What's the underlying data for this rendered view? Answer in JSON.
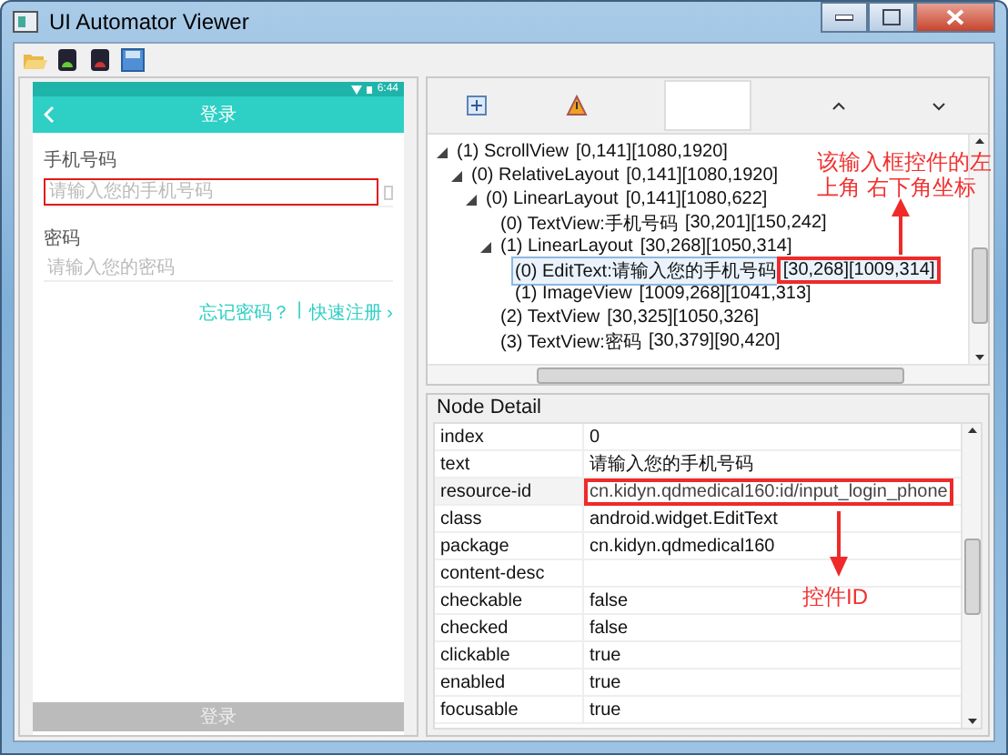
{
  "window": {
    "title": "UI Automator Viewer"
  },
  "device": {
    "status_time": "6:44",
    "header_title": "登录",
    "fields": [
      {
        "label": "手机号码",
        "placeholder": "请输入您的手机号码"
      },
      {
        "label": "密码",
        "placeholder": "请输入您的密码"
      }
    ],
    "links": [
      "忘记密码？",
      "|",
      "快速注册 ›"
    ],
    "submit": "登录"
  },
  "tree": {
    "nodes": [
      {
        "label": "(1) ScrollView",
        "bounds": "[0,141][1080,1920]",
        "expanded": true,
        "selected": false,
        "children": [
          {
            "label": "(0) RelativeLayout",
            "bounds": "[0,141][1080,1920]",
            "expanded": true,
            "selected": false,
            "children": [
              {
                "label": "(0) LinearLayout",
                "bounds": "[0,141][1080,622]",
                "expanded": true,
                "selected": false,
                "children": [
                  {
                    "label": "(0) TextView:手机号码",
                    "bounds": "[30,201][150,242]",
                    "expanded": false,
                    "selected": false
                  },
                  {
                    "label": "(1) LinearLayout",
                    "bounds": "[30,268][1050,314]",
                    "expanded": true,
                    "selected": false,
                    "children": [
                      {
                        "label": "(0) EditText:请输入您的手机号码",
                        "bounds": "[30,268][1009,314]",
                        "expanded": false,
                        "selected": true
                      },
                      {
                        "label": "(1) ImageView",
                        "bounds": "[1009,268][1041,313]",
                        "expanded": false,
                        "selected": false
                      }
                    ]
                  },
                  {
                    "label": "(2) TextView",
                    "bounds": "[30,325][1050,326]",
                    "expanded": false,
                    "selected": false
                  },
                  {
                    "label": "(3) TextView:密码",
                    "bounds": "[30,379][90,420]",
                    "expanded": false,
                    "selected": false
                  }
                ]
              }
            ]
          }
        ]
      }
    ]
  },
  "node_detail": {
    "title": "Node Detail",
    "rows": [
      {
        "name": "index",
        "value": "0",
        "selected": false
      },
      {
        "name": "text",
        "value": "请输入您的手机号码",
        "selected": false
      },
      {
        "name": "resource-id",
        "value": "cn.kidyn.qdmedical160:id/input_login_phone",
        "selected": true
      },
      {
        "name": "class",
        "value": "android.widget.EditText",
        "selected": false
      },
      {
        "name": "package",
        "value": "cn.kidyn.qdmedical160",
        "selected": false
      },
      {
        "name": "content-desc",
        "selected": false
      },
      {
        "name": "checkable",
        "value": "false",
        "selected": false
      },
      {
        "name": "checked",
        "value": "false",
        "selected": false
      },
      {
        "name": "clickable",
        "value": "true",
        "selected": false
      },
      {
        "name": "enabled",
        "value": "true",
        "selected": false
      },
      {
        "name": "focusable",
        "value": "true",
        "selected": false
      }
    ]
  },
  "annotations": [
    {
      "text": "该输入框控件的左上角 右下角坐标"
    },
    {
      "text": "控件ID"
    }
  ]
}
